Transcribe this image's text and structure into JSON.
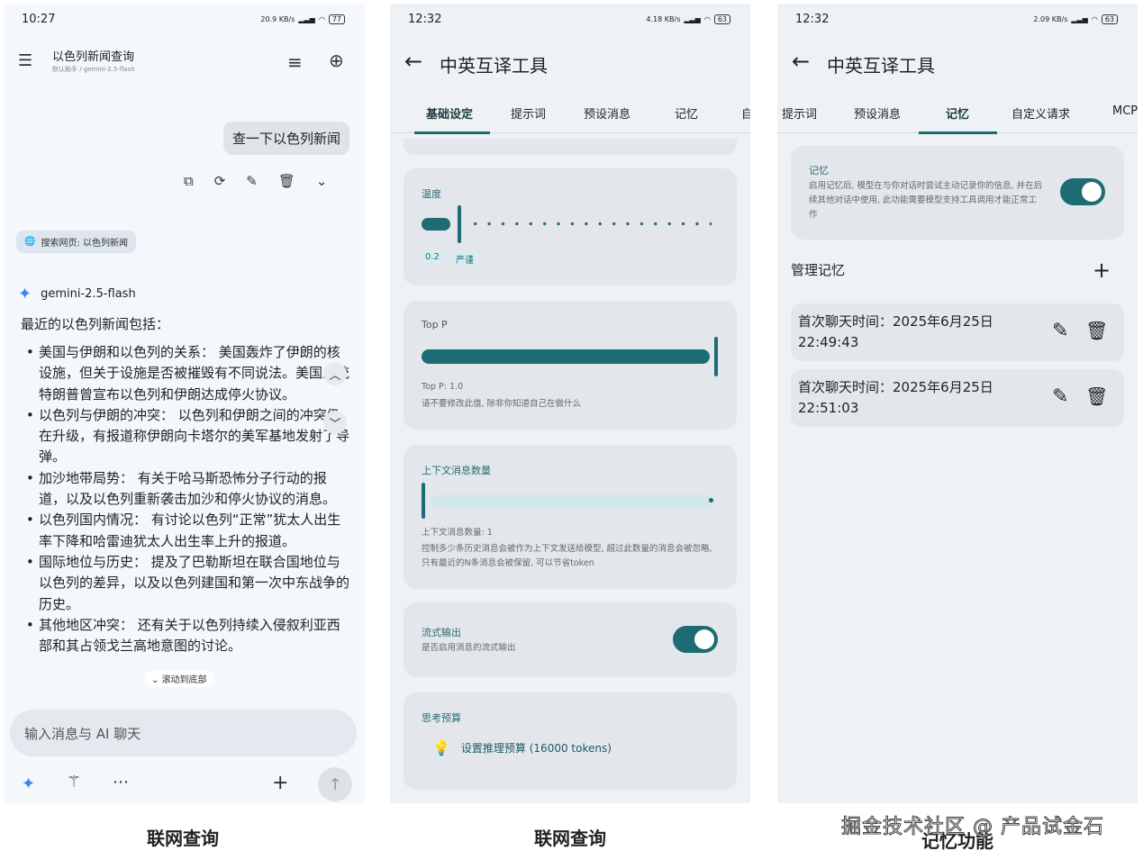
{
  "phone1": {
    "status": {
      "time": "10:27",
      "speed": "20.9 KB/s",
      "battery": "77"
    },
    "header": {
      "title": "以色列新闻查询",
      "subtitle": "默认助手 / gemini-2.5-flash"
    },
    "user_message": "查一下以色列新闻",
    "search_chip": "搜索网页: 以色列新闻",
    "model_name": "gemini-2.5-flash",
    "intro": "最近的以色列新闻包括：",
    "news_items": [
      "美国与伊朗和以色列的关系： 美国轰炸了伊朗的核设施，但关于设施是否被摧毁有不同说法。美国总统特朗普曾宣布以色列和伊朗达成停火协议。",
      "以色列与伊朗的冲突： 以色列和伊朗之间的冲突仍在升级，有报道称伊朗向卡塔尔的美军基地发射了导弹。",
      "加沙地带局势： 有关于哈马斯恐怖分子行动的报道，以及以色列重新袭击加沙和停火协议的消息。",
      "以色列国内情况： 有讨论以色列“正常”犹太人出生率下降和哈雷迪犹太人出生率上升的报道。",
      "国际地位与历史： 提及了巴勒斯坦在联合国地位与以色列的差异，以及以色列建国和第一次中东战争的历史。",
      "其他地区冲突： 还有关于以色列持续入侵叙利亚西部和其占领戈兰高地意图的讨论。"
    ],
    "scroll_to_bottom": "滚动到底部",
    "input_placeholder": "输入消息与 AI 聊天"
  },
  "phone2": {
    "status": {
      "time": "12:32",
      "speed": "4.18 KB/s",
      "battery": "63"
    },
    "title": "中英互译工具",
    "tabs": [
      "基础设定",
      "提示词",
      "预设消息",
      "记忆",
      "自"
    ],
    "temperature": {
      "title": "温度",
      "value": "0.2",
      "label": "严谨",
      "level": 0.1
    },
    "top_p": {
      "title": "Top P",
      "value_text": "Top P: 1.0",
      "hint": "请不要修改此值, 除非你知道自己在做什么",
      "level": 1.0
    },
    "context": {
      "title": "上下文消息数量",
      "value_text": "上下文消息数量: 1",
      "desc": "控制多少条历史消息会被作为上下文发送给模型, 超过此数量的消息会被忽略, 只有最近的N条消息会被保留, 可以节省token",
      "level": 0.0
    },
    "stream": {
      "title": "流式输出",
      "desc": "是否启用消息的流式输出",
      "enabled": true
    },
    "thinking": {
      "title": "思考预算",
      "button": "设置推理预算 (16000 tokens)"
    }
  },
  "phone3": {
    "status": {
      "time": "12:32",
      "speed": "2.09 KB/s",
      "battery": "63"
    },
    "title": "中英互译工具",
    "tabs": [
      "提示词",
      "预设消息",
      "记忆",
      "自定义请求",
      "MCP"
    ],
    "memory": {
      "title": "记忆",
      "desc": "启用记忆后, 模型在与你对话时尝试主动记录你的信息, 并在后续其他对话中使用, 此功能需要模型支持工具调用才能正常工作",
      "enabled": true
    },
    "manage_title": "管理记忆",
    "memories": [
      {
        "text": "首次聊天时间：2025年6月25日 22:49:43"
      },
      {
        "text": "首次聊天时间：2025年6月25日 22:51:03"
      }
    ]
  },
  "captions": [
    "联网查询",
    "联网查询",
    "记忆功能"
  ],
  "watermark": "掘金技术社区 @ 产品试金石",
  "colors": {
    "accent": "#1d6b73",
    "card": "#e3e7eb"
  }
}
